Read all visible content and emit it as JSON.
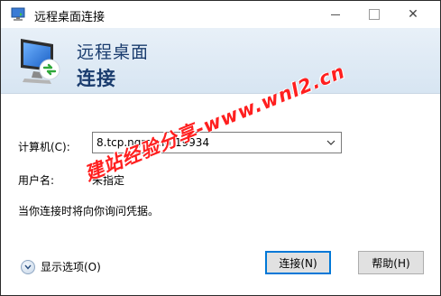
{
  "window": {
    "title": "远程桌面连接",
    "close_glyph": "✕"
  },
  "header": {
    "line1": "远程桌面",
    "line2": "连接"
  },
  "form": {
    "computer_label": "计算机(C):",
    "computer_value": "8.tcp.ngrok.io:19934",
    "user_label": "用户名:",
    "user_value": "未指定",
    "note": "当你连接时将向你询问凭据。"
  },
  "footer": {
    "options_label": "显示选项(O)",
    "connect_label": "连接(N)",
    "help_label": "帮助(H)"
  },
  "watermark": {
    "text": "建站经验分享-www.wnl2.cn"
  },
  "colors": {
    "header_text": "#1a3c6e",
    "accent": "#0078d7",
    "watermark": "#ff1f1f"
  }
}
